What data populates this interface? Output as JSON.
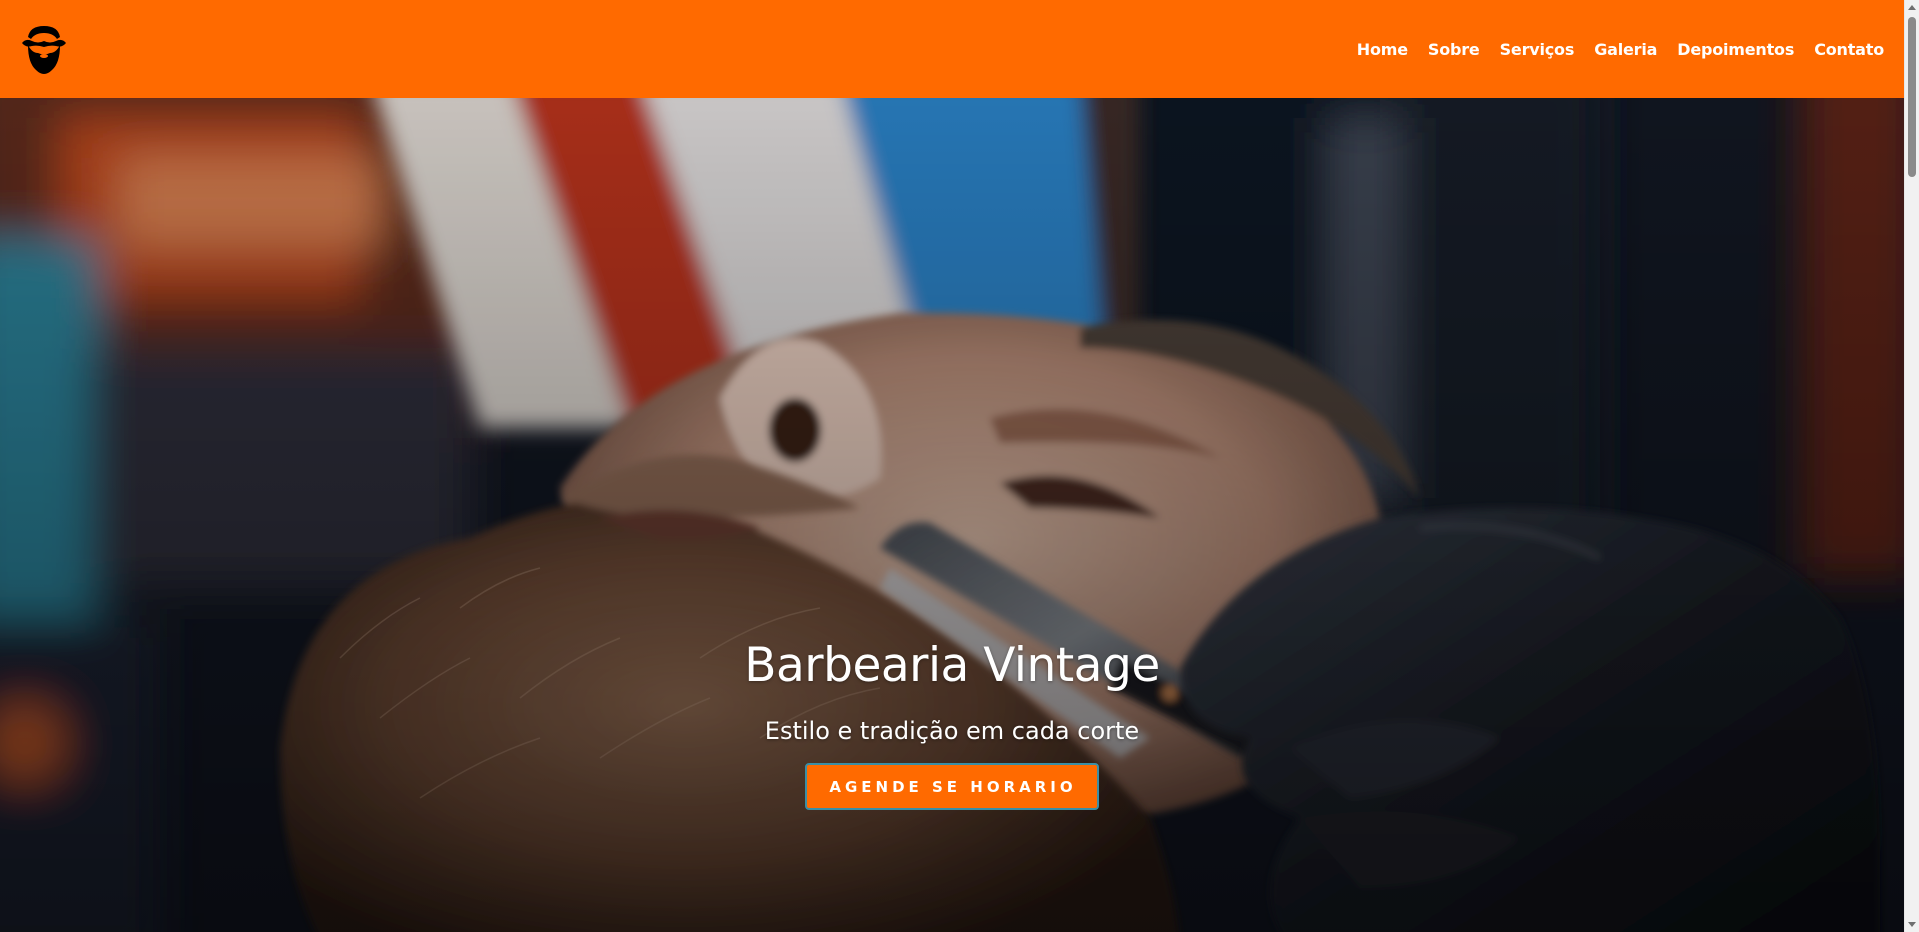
{
  "brand": {
    "logo_icon": "bearded-man-icon",
    "accent_color": "#ff6a00"
  },
  "nav": {
    "items": [
      {
        "label": "Home"
      },
      {
        "label": "Sobre"
      },
      {
        "label": "Serviços"
      },
      {
        "label": "Galeria"
      },
      {
        "label": "Depoimentos"
      },
      {
        "label": "Contato"
      }
    ]
  },
  "hero": {
    "title": "Barbearia Vintage",
    "subtitle": "Estilo e tradição em cada corte",
    "cta_label": "AGENDE SE HORARIO",
    "background_icon": "barber-shaving-photo"
  }
}
